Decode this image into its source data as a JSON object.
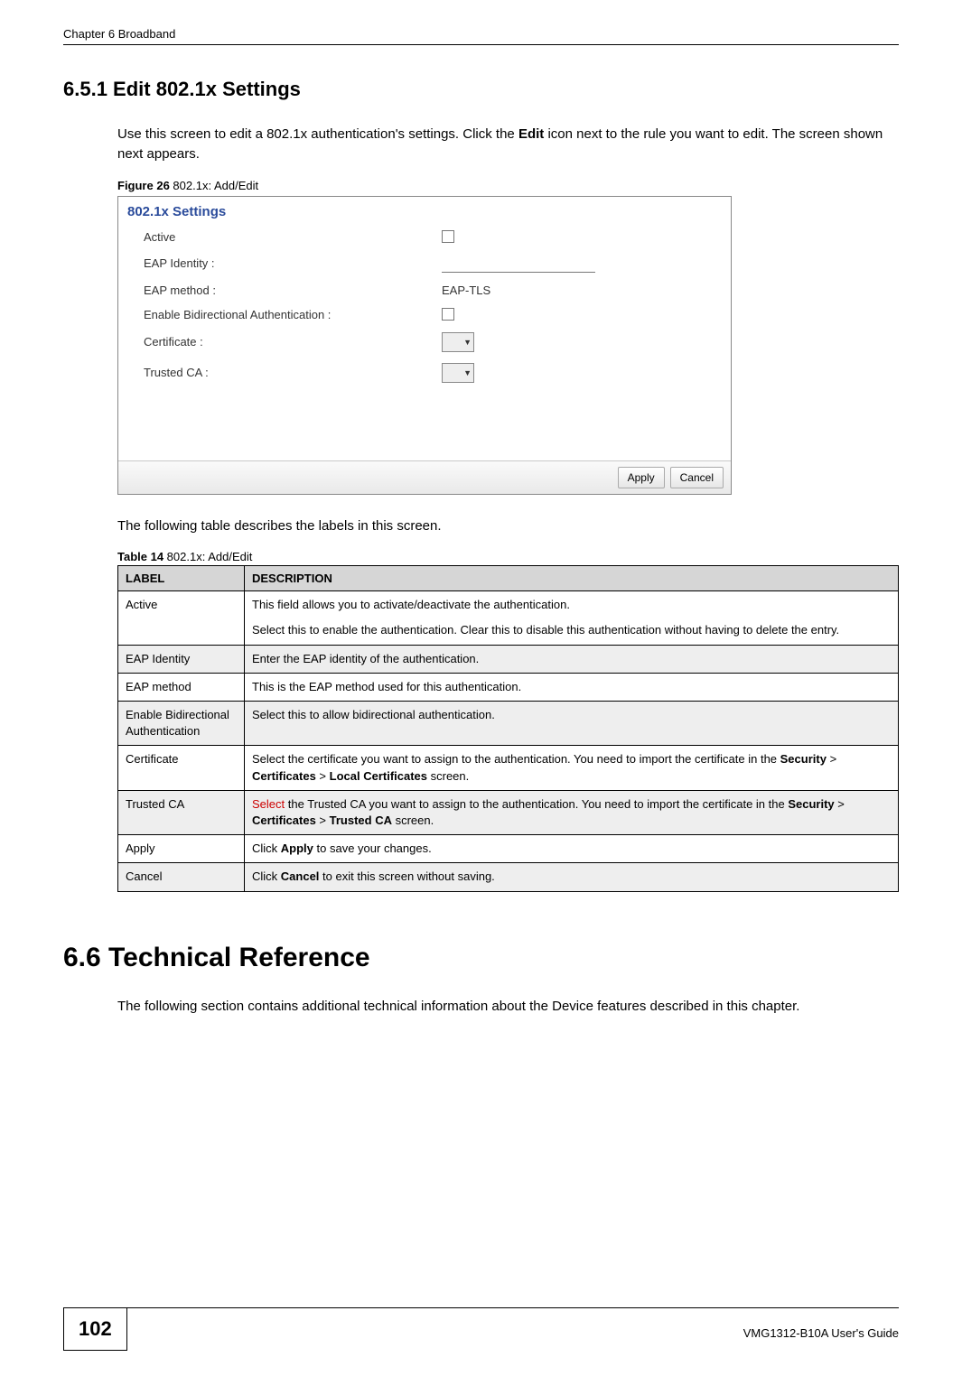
{
  "header": {
    "chapter_ref": "Chapter 6 Broadband"
  },
  "section651": {
    "number_title": "6.5.1  Edit 802.1x Settings",
    "intro_pre": "Use this screen to edit a 802.1x authentication's settings. Click the ",
    "intro_bold": "Edit",
    "intro_post": " icon next to the rule you want to edit. The screen shown next appears."
  },
  "figure26": {
    "label": "Figure 26",
    "caption": "   802.1x: Add/Edit",
    "dialog": {
      "title": "802.1x Settings",
      "rows": {
        "active": "Active",
        "eap_identity": "EAP Identity :",
        "eap_method": "EAP method :",
        "eap_method_value": "EAP-TLS",
        "enable_bidir": "Enable Bidirectional Authentication :",
        "certificate": "Certificate :",
        "trusted_ca": "Trusted CA :"
      },
      "buttons": {
        "apply": "Apply",
        "cancel": "Cancel"
      }
    }
  },
  "after_figure_text": "The following table describes the labels in this screen.",
  "table14": {
    "label": "Table 14",
    "caption": "   802.1x: Add/Edit",
    "headers": {
      "label": "LABEL",
      "description": "DESCRIPTION"
    },
    "rows": [
      {
        "label": "Active",
        "desc_p1": "This field allows you to activate/deactivate the authentication.",
        "desc_p2": "Select this to enable the authentication. Clear this to disable this authentication without having to delete the entry."
      },
      {
        "label": "EAP Identity",
        "desc_p1": "Enter the EAP identity of the authentication."
      },
      {
        "label": "EAP method",
        "desc_p1": "This is the EAP method used for this authentication."
      },
      {
        "label": "Enable Bidirectional Authentication",
        "desc_p1": "Select this to allow bidirectional authentication."
      },
      {
        "label": "Certificate",
        "desc_pre": "Select the certificate you want to assign to the authentication. You need to import the certificate in the ",
        "b1": "Security",
        "sep1": " > ",
        "b2": "Certificates",
        "sep2": " > ",
        "b3": "Local Certificates",
        "desc_post": " screen."
      },
      {
        "label": "Trusted CA",
        "red": "Select",
        "desc_pre": " the Trusted CA you want to assign to the authentication. You need to import the certificate in the ",
        "b1": "Security",
        "sep1": " > ",
        "b2": "Certificates",
        "sep2": " > ",
        "b3": "Trusted CA",
        "desc_post": " screen."
      },
      {
        "label": "Apply",
        "desc_pre": "Click ",
        "b1": "Apply",
        "desc_post": " to save your changes."
      },
      {
        "label": "Cancel",
        "desc_pre": "Click ",
        "b1": "Cancel",
        "desc_post": " to exit this screen without saving."
      }
    ]
  },
  "section66": {
    "number_title": "6.6  Technical Reference",
    "body": "The following section contains additional technical information about the Device features described in this chapter."
  },
  "footer": {
    "page_number": "102",
    "guide": "VMG1312-B10A User's Guide"
  }
}
